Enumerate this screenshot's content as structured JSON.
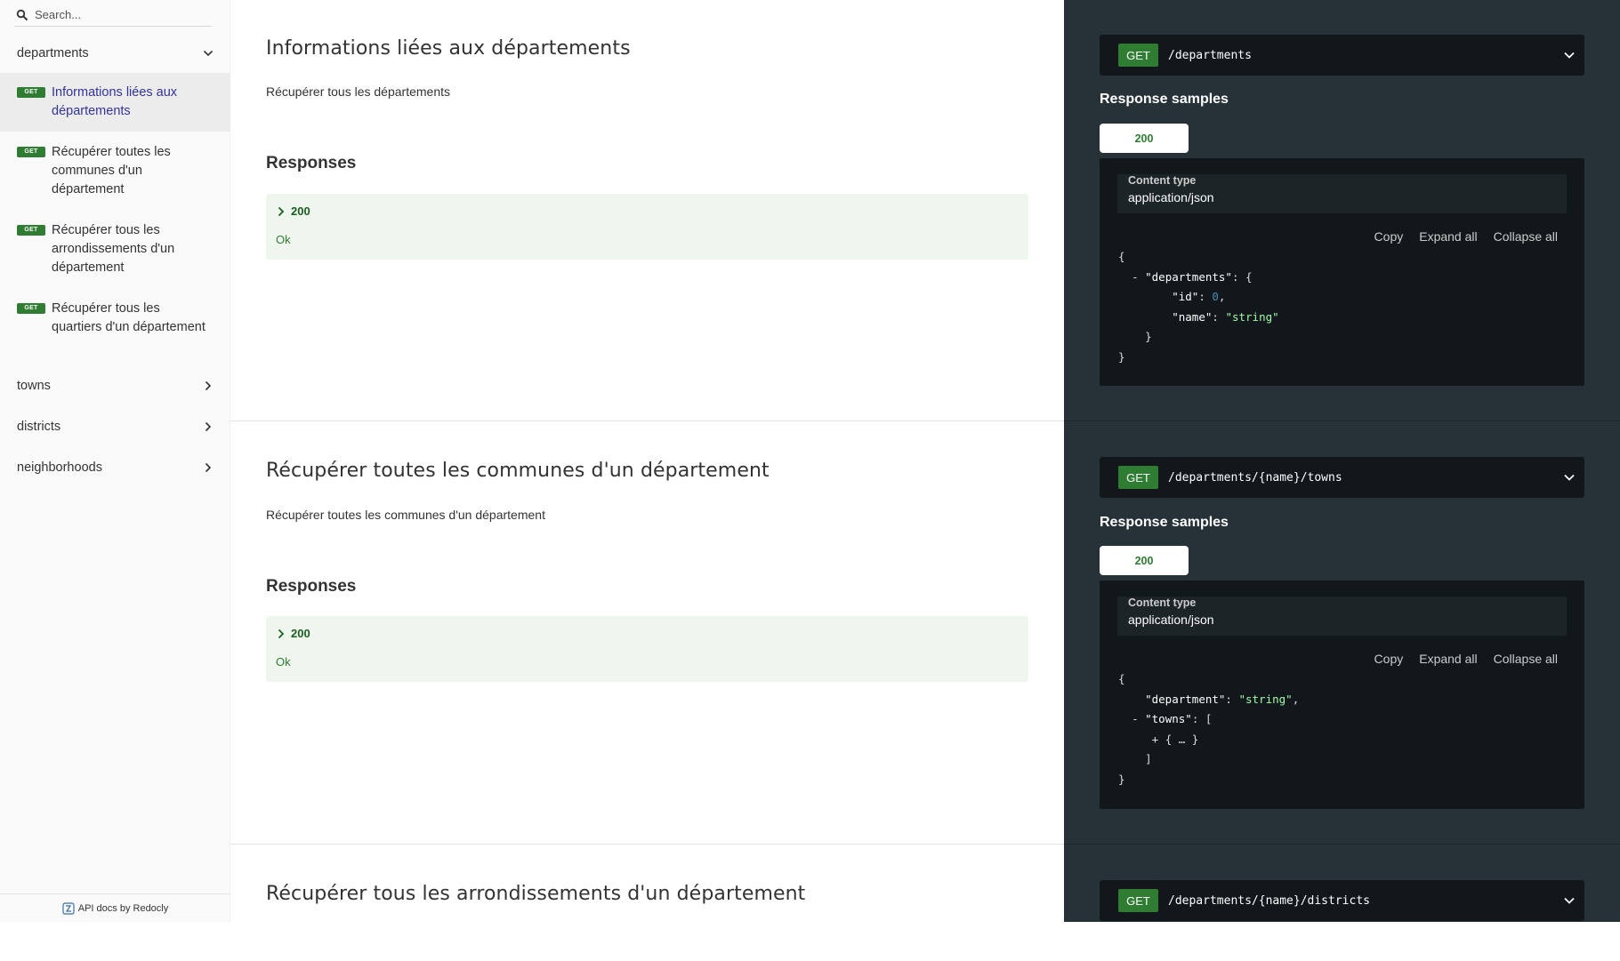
{
  "sidebar": {
    "search_placeholder": "Search...",
    "groups": [
      {
        "label": "departments"
      },
      {
        "label": "towns"
      },
      {
        "label": "districts"
      },
      {
        "label": "neighborhoods"
      }
    ],
    "items": [
      {
        "badge": "GET",
        "label": "Informations liées aux départements"
      },
      {
        "badge": "GET",
        "label": "Récupérer toutes les communes d'un département"
      },
      {
        "badge": "GET",
        "label": "Récupérer tous les arrondissements d'un département"
      },
      {
        "badge": "GET",
        "label": "Récupérer tous les quartiers d'un département"
      }
    ],
    "footer": "API docs by Redocly"
  },
  "operations": [
    {
      "title": "Informations liées aux départements",
      "description": "Récupérer tous les départements",
      "responses_heading": "Responses",
      "response_code": "200",
      "response_desc": "Ok",
      "method": "GET",
      "path": "/departments",
      "samples_title": "Response samples",
      "tab": "200",
      "content_type_label": "Content type",
      "content_type": "application/json",
      "actions": [
        "Copy",
        "Expand all",
        "Collapse all"
      ]
    },
    {
      "title": "Récupérer toutes les communes d'un département",
      "description": "Récupérer toutes les communes d'un département",
      "responses_heading": "Responses",
      "response_code": "200",
      "response_desc": "Ok",
      "method": "GET",
      "path": "/departments/{name}/towns",
      "samples_title": "Response samples",
      "tab": "200",
      "content_type_label": "Content type",
      "content_type": "application/json",
      "actions": [
        "Copy",
        "Expand all",
        "Collapse all"
      ]
    },
    {
      "title": "Récupérer tous les arrondissements d'un département",
      "method": "GET",
      "path": "/departments/{name}/districts"
    }
  ],
  "code_samples": {
    "s1": {
      "open": "{",
      "minus": "-",
      "key_departments": "\"departments\"",
      "colon_brace": ": {",
      "key_id": "\"id\"",
      "colon": ":",
      "val_id": "0",
      "comma": ",",
      "key_name": "\"name\"",
      "val_name": "\"string\"",
      "inner_close": "}",
      "close": "}"
    },
    "s2": {
      "open": "{",
      "key_department": "\"department\"",
      "colon": ":",
      "val_department": "\"string\"",
      "comma": ",",
      "minus": "-",
      "key_towns": "\"towns\"",
      "colon_bracket": ": [",
      "plus": "+",
      "collapsed": "{ … }",
      "bracket_close": "]",
      "close": "}"
    }
  },
  "colors": {
    "get_badge": "#2e7d32",
    "right_panel_bg": "#263238",
    "code_bg": "#11171a",
    "active_item": "#32329f",
    "string_value": "#a0fbaa",
    "number_value": "#4a8bb3"
  }
}
